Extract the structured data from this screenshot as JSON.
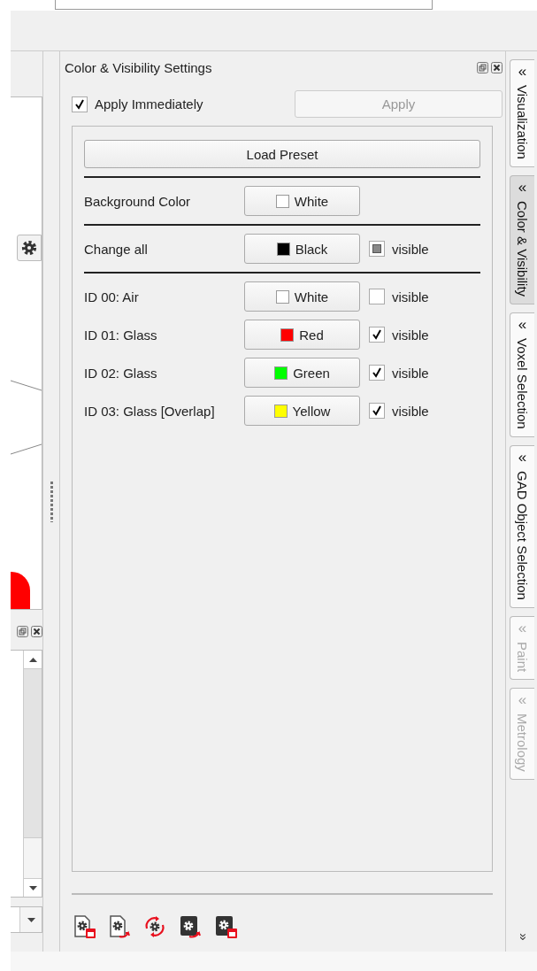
{
  "panel": {
    "title": "Color & Visibility Settings",
    "apply_immediately": {
      "label": "Apply Immediately",
      "checked": true
    },
    "apply_button": {
      "label": "Apply",
      "disabled": true
    },
    "load_preset": "Load Preset",
    "background": {
      "label": "Background Color",
      "button": "White",
      "color": "#ffffff"
    },
    "change_all": {
      "label": "Change all",
      "button": "Black",
      "color": "#000000",
      "visible": {
        "label": "visible",
        "partial": true
      }
    },
    "materials": [
      {
        "label": "ID 00: Air",
        "button": "White",
        "color": "#ffffff",
        "visible": {
          "label": "visible",
          "checked": false
        }
      },
      {
        "label": "ID 01: Glass",
        "button": "Red",
        "color": "#ff0000",
        "visible": {
          "label": "visible",
          "checked": true
        }
      },
      {
        "label": "ID 02: Glass",
        "button": "Green",
        "color": "#00ff00",
        "visible": {
          "label": "visible",
          "checked": true
        }
      },
      {
        "label": "ID 03: Glass [Overlap]",
        "button": "Yellow",
        "color": "#ffff00",
        "visible": {
          "label": "visible",
          "checked": true
        }
      }
    ]
  },
  "side_tabs": [
    {
      "chevron": "«",
      "label": "Visualization",
      "selected": false,
      "disabled": false
    },
    {
      "chevron": "«",
      "label": "Color & Visibility",
      "selected": true,
      "disabled": false
    },
    {
      "chevron": "«",
      "label": "Voxel Selection",
      "selected": false,
      "disabled": false
    },
    {
      "chevron": "«",
      "label": "GAD Object Selection",
      "selected": false,
      "disabled": false
    },
    {
      "chevron": "«",
      "label": "Paint",
      "selected": false,
      "disabled": true
    },
    {
      "chevron": "«",
      "label": "Metrology",
      "selected": false,
      "disabled": true
    }
  ],
  "side_overflow": "»"
}
